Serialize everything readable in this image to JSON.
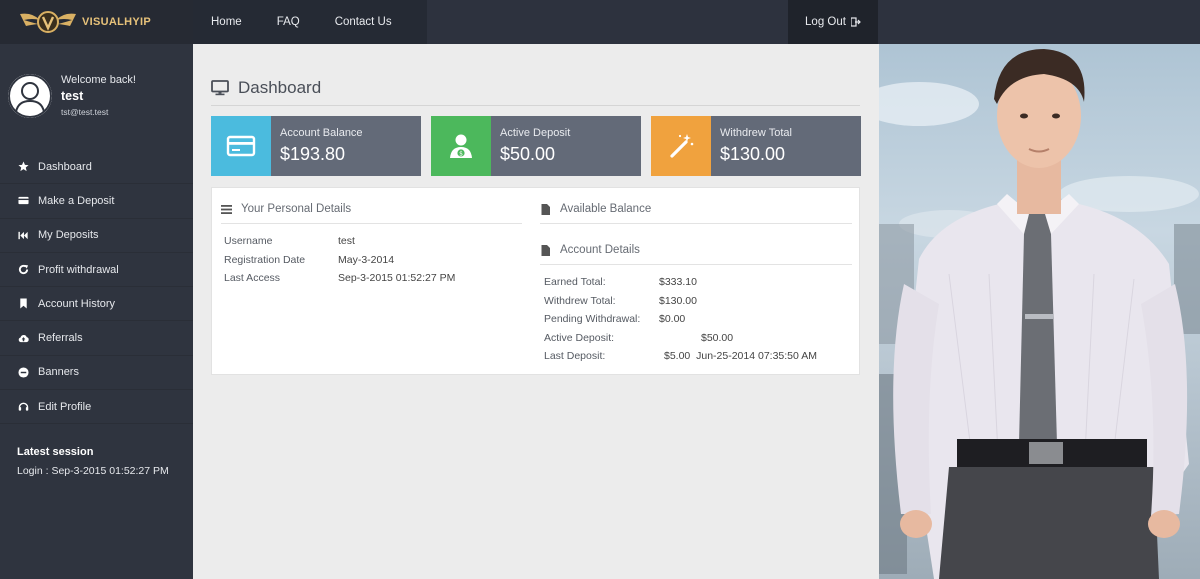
{
  "brand": {
    "name": "VISUALHYIP",
    "logo_icon": "winged-v-crest-icon",
    "accent": "#e7c27a"
  },
  "nav": {
    "items": [
      {
        "label": "Home"
      },
      {
        "label": "FAQ"
      },
      {
        "label": "Contact Us"
      }
    ],
    "logout_label": "Log Out"
  },
  "user": {
    "welcome": "Welcome back!",
    "username": "test",
    "email": "tst@test.test"
  },
  "sidebar": {
    "items": [
      {
        "label": "Dashboard",
        "icon": "star-icon"
      },
      {
        "label": "Make a Deposit",
        "icon": "card-icon"
      },
      {
        "label": "My Deposits",
        "icon": "fast-forward-icon"
      },
      {
        "label": "Profit withdrawal",
        "icon": "refresh-icon"
      },
      {
        "label": "Account History",
        "icon": "bookmark-icon"
      },
      {
        "label": "Referrals",
        "icon": "cloud-upload-icon"
      },
      {
        "label": "Banners",
        "icon": "minus-circle-icon"
      },
      {
        "label": "Edit Profile",
        "icon": "headset-icon"
      }
    ],
    "session_title": "Latest session",
    "session_login": "Login : Sep-3-2015 01:52:27 PM"
  },
  "page": {
    "title": "Dashboard",
    "stats": [
      {
        "label": "Account Balance",
        "value": "$193.80",
        "color": "#4bbbde",
        "icon": "credit-card-icon"
      },
      {
        "label": "Active Deposit",
        "value": "$50.00",
        "color": "#4cb85c",
        "icon": "user-money-icon"
      },
      {
        "label": "Withdrew Total",
        "value": "$130.00",
        "color": "#f0a23e",
        "icon": "magic-wand-icon"
      }
    ],
    "personal": {
      "heading": "Your Personal Details",
      "rows": [
        {
          "key": "Username",
          "value": "test"
        },
        {
          "key": "Registration Date",
          "value": "May-3-2014"
        },
        {
          "key": "Last Access",
          "value": "Sep-3-2015 01:52:27 PM"
        }
      ]
    },
    "available_heading": "Available Balance",
    "account": {
      "heading": "Account Details",
      "rows": [
        {
          "key": "Earned Total:",
          "value": "$333.10"
        },
        {
          "key": "Withdrew Total:",
          "value": "$130.00"
        },
        {
          "key": "Pending Withdrawal:",
          "value": "$0.00"
        },
        {
          "key": "Active Deposit:",
          "value": "$50.00"
        },
        {
          "key": "Last Deposit:",
          "value": "$5.00  Jun-25-2014 07:35:50 AM"
        }
      ]
    }
  }
}
